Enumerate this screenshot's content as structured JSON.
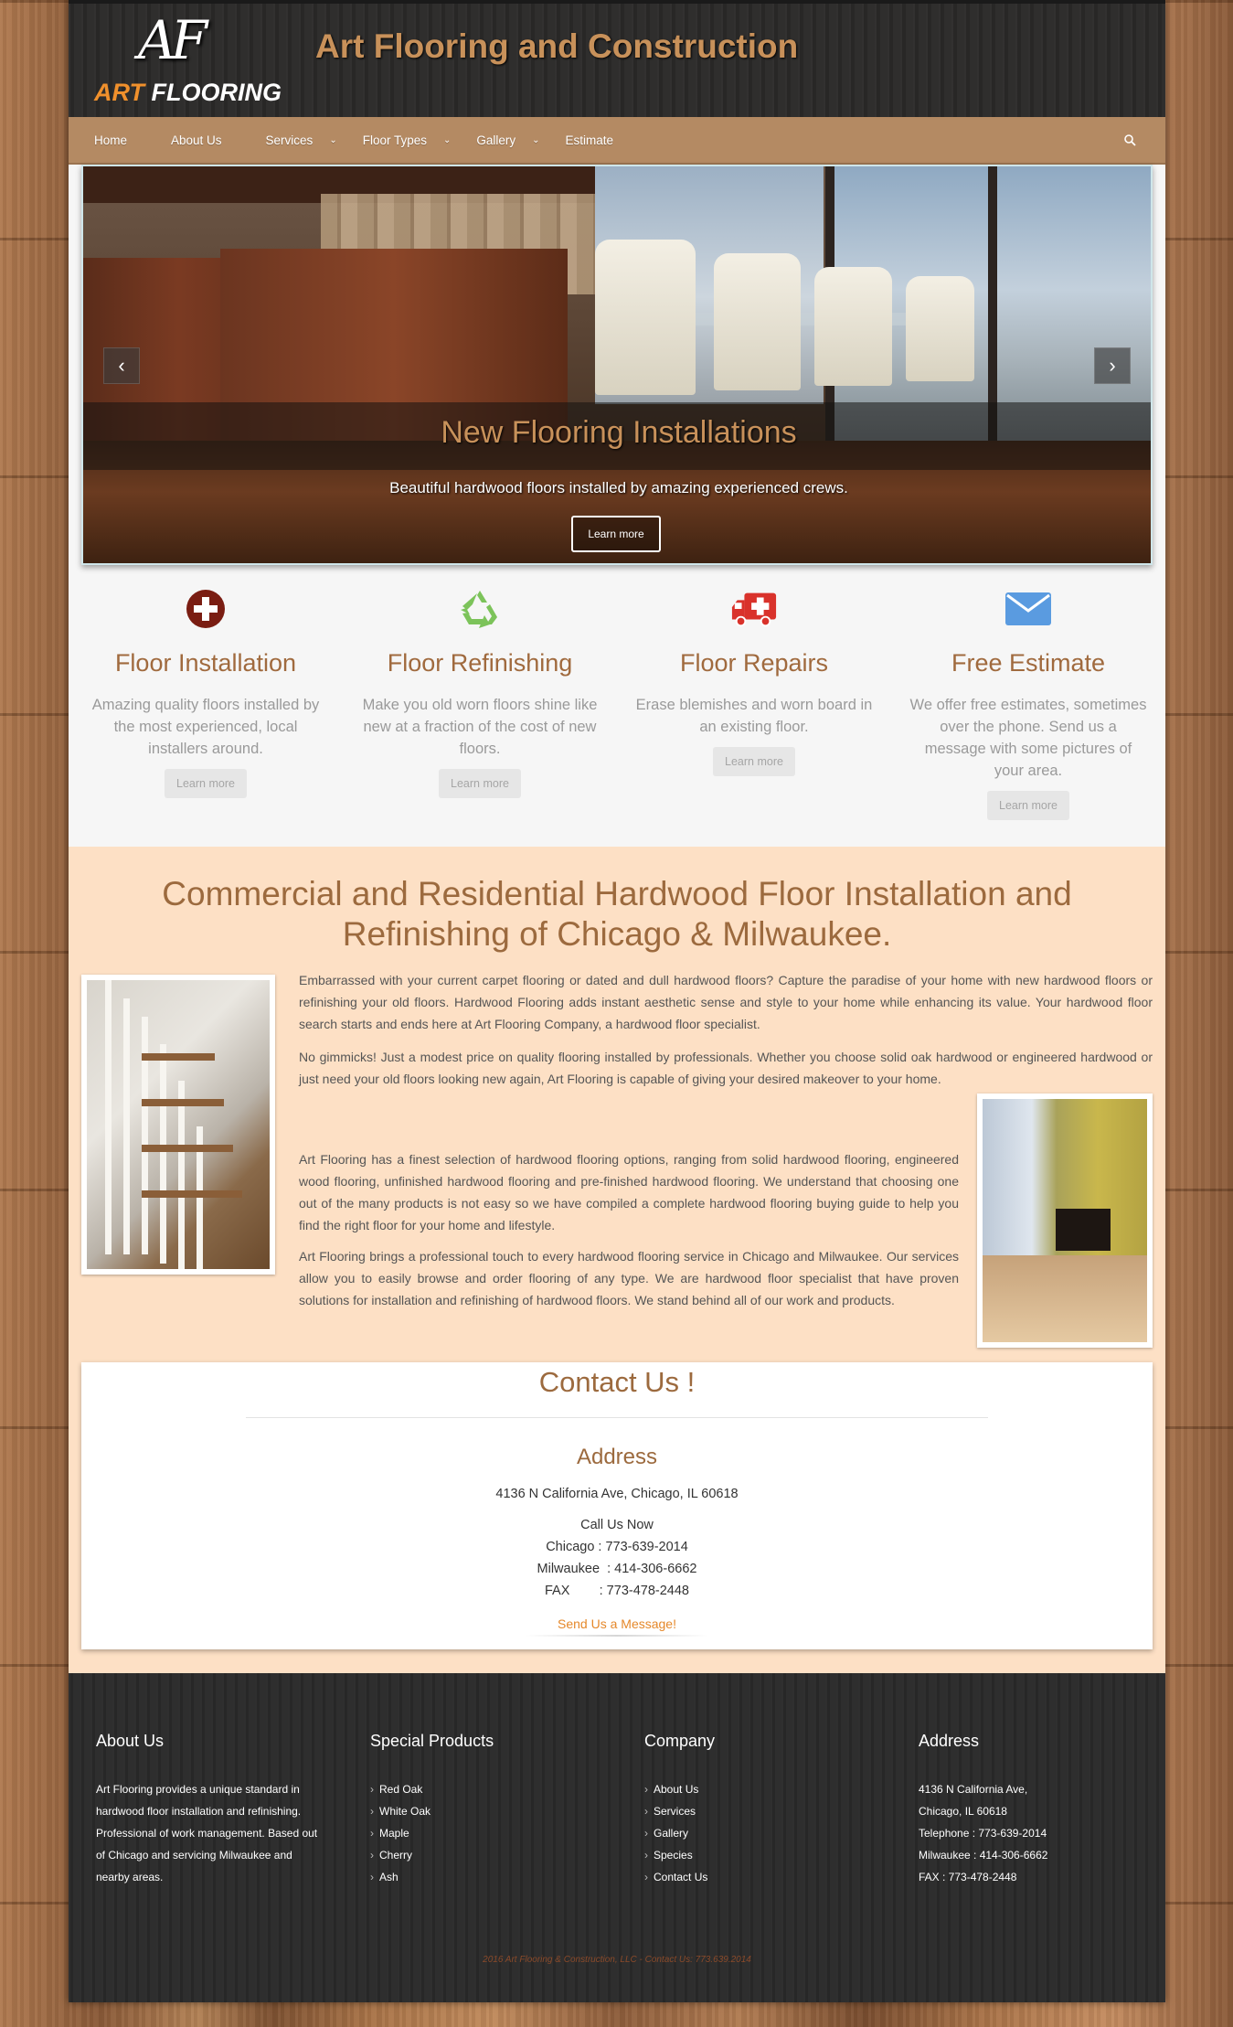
{
  "header": {
    "logo_mono": "AF",
    "logo_art": "ART",
    "logo_flooring": "FLOORING",
    "site_title": "Art Flooring and Construction"
  },
  "nav": {
    "items": [
      "Home",
      "About Us",
      "Services",
      "Floor Types",
      "Gallery",
      "Estimate"
    ],
    "search_icon": "search-icon"
  },
  "slider": {
    "title": "New Flooring Installations",
    "subtitle": "Beautiful hardwood floors installed by amazing experienced crews.",
    "button": "Learn more",
    "prev": "‹",
    "next": "›"
  },
  "features": [
    {
      "icon": "plus-circle-icon",
      "title": "Floor Installation",
      "text": "Amazing quality floors installed by the most experienced, local installers around.",
      "button": "Learn more"
    },
    {
      "icon": "recycle-icon",
      "title": "Floor Refinishing",
      "text": "Make you old worn floors shine like new at a fraction of the cost of new floors.",
      "button": "Learn more"
    },
    {
      "icon": "ambulance-icon",
      "title": "Floor Repairs",
      "text": "Erase blemishes and worn board in an existing floor.",
      "button": "Learn more"
    },
    {
      "icon": "envelope-icon",
      "title": "Free Estimate",
      "text": "We offer free estimates, sometimes over the phone. Send us a message with some pictures of your area.",
      "button": "Learn more"
    }
  ],
  "colors": {
    "accent": "#c8915a",
    "nav": "#b48a63",
    "peach": "#fde0c5",
    "link": "#e5882a",
    "plus": "#7a1d12",
    "recycle": "#7cc35a",
    "ambulance": "#d9322b",
    "envelope": "#5a9be0"
  },
  "about": {
    "title": "Commercial and Residential Hardwood Floor Installation and Refinishing of Chicago & Milwaukee.",
    "p1": "Embarrassed with your current carpet flooring or dated and dull hardwood floors? Capture the paradise of your home with new hardwood floors or refinishing your old floors. Hardwood Flooring adds instant aesthetic sense and style to your home while enhancing its value. Your hardwood floor search starts and ends here at Art Flooring Company, a hardwood floor specialist.",
    "p2": "No gimmicks! Just a modest price on quality flooring installed by professionals. Whether you choose solid oak hardwood or engineered hardwood or just need your old floors looking new again, Art Flooring is capable of giving your desired makeover to your home.",
    "p3": "Art Flooring has a finest selection of hardwood flooring options, ranging from solid hardwood flooring, engineered wood flooring, unfinished hardwood flooring and pre-finished hardwood flooring. We understand that choosing one out of the many products is not easy so we have compiled a complete hardwood flooring buying guide to help you find the right floor for your home and lifestyle.",
    "p4": "Art Flooring brings a professional touch to every hardwood flooring service in Chicago and Milwaukee. Our services allow you to easily browse and order flooring of any type. We are hardwood floor specialist that have proven solutions for installation and refinishing of hardwood floors. We stand behind all of our work and products."
  },
  "contact": {
    "title": "Contact Us !",
    "address_heading": "Address",
    "address": "4136 N California Ave, Chicago, IL 60618",
    "call": "Call Us Now",
    "chicago": "Chicago : 773-639-2014",
    "milwaukee": "Milwaukee  : 414-306-6662",
    "fax": "FAX        : 773-478-2448",
    "link": "Send Us a Message!"
  },
  "footer": {
    "about": {
      "heading": "About Us",
      "text": "Art Flooring provides a unique standard in hardwood floor installation and refinishing. Professional of work management. Based out of Chicago and servicing Milwaukee and nearby areas."
    },
    "products": {
      "heading": "Special Products",
      "items": [
        "Red Oak",
        "White Oak",
        "Maple",
        "Cherry",
        "Ash"
      ]
    },
    "company": {
      "heading": "Company",
      "items": [
        "About Us",
        "Services",
        "Gallery",
        "Species",
        "Contact Us"
      ]
    },
    "address": {
      "heading": "Address",
      "lines": [
        "4136 N California Ave,",
        "Chicago, IL 60618",
        "Telephone : 773-639-2014",
        "Milwaukee : 414-306-6662",
        "FAX : 773-478-2448"
      ]
    },
    "copyright": "2016 Art Flooring & Construction, LLC - Contact Us: 773.639.2014"
  }
}
